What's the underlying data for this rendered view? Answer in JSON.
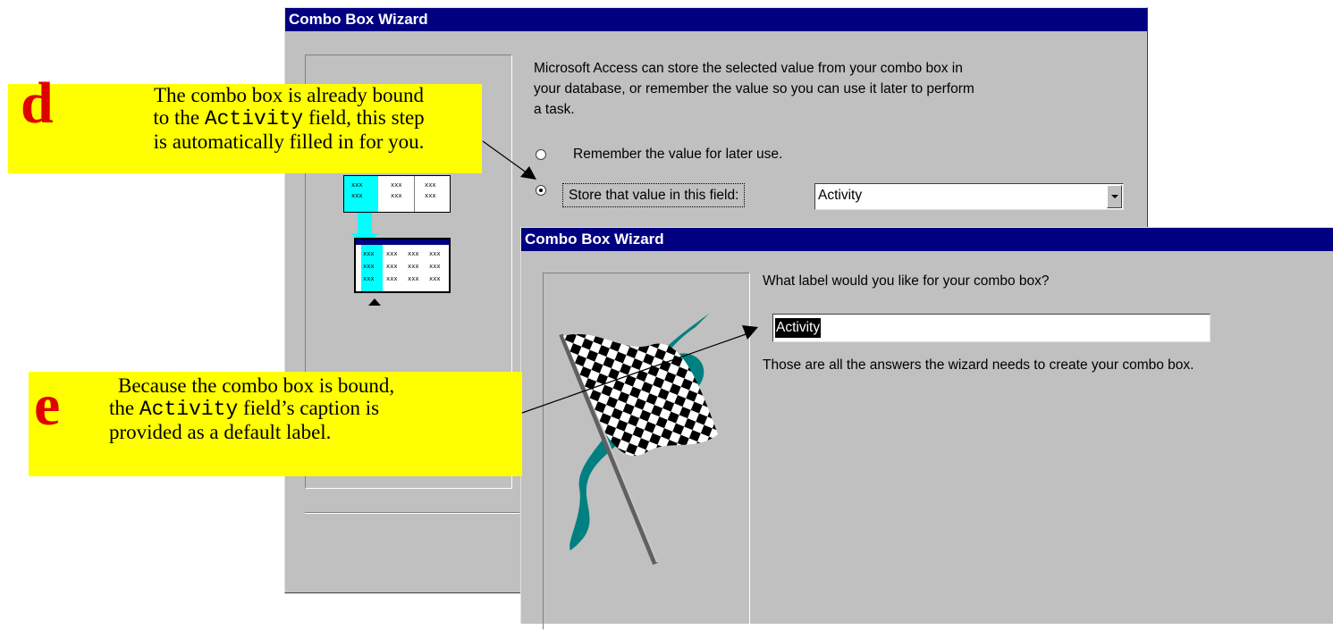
{
  "wizard1": {
    "title": "Combo Box Wizard",
    "description": "Microsoft Access can store the selected value from your combo box in your database, or remember the value so you can use it later to perform a task.",
    "option_remember": "Remember the value for later use.",
    "option_store": "Store that value in this field:",
    "selected_option": "store",
    "store_field_value": "Activity",
    "illustration_cell_text": "xxx"
  },
  "wizard2": {
    "title": "Combo Box Wizard",
    "question": "What label would you like for your combo box?",
    "label_value": "Activity",
    "finish_text": "Those are all the answers the wizard needs to create your combo box."
  },
  "callout_d": {
    "letter": "d",
    "line1": "The combo box is already bound",
    "line2_before": "to the ",
    "line2_code": "Activity",
    "line2_after": " field, this step",
    "line3": "is automatically filled in for you."
  },
  "callout_e": {
    "letter": "e",
    "line1": "Because the combo box is bound,",
    "line2_before": "the ",
    "line2_code": "Activity",
    "line2_after": " field’s caption is",
    "line3": "provided as a default label."
  },
  "colors": {
    "titlebar": "#000080",
    "dialog_face": "#c0c0c0",
    "callout_bg": "#ffff00",
    "callout_letter": "#e10000",
    "illustration_cyan": "#00ffff",
    "flag_swoosh": "#008080"
  }
}
